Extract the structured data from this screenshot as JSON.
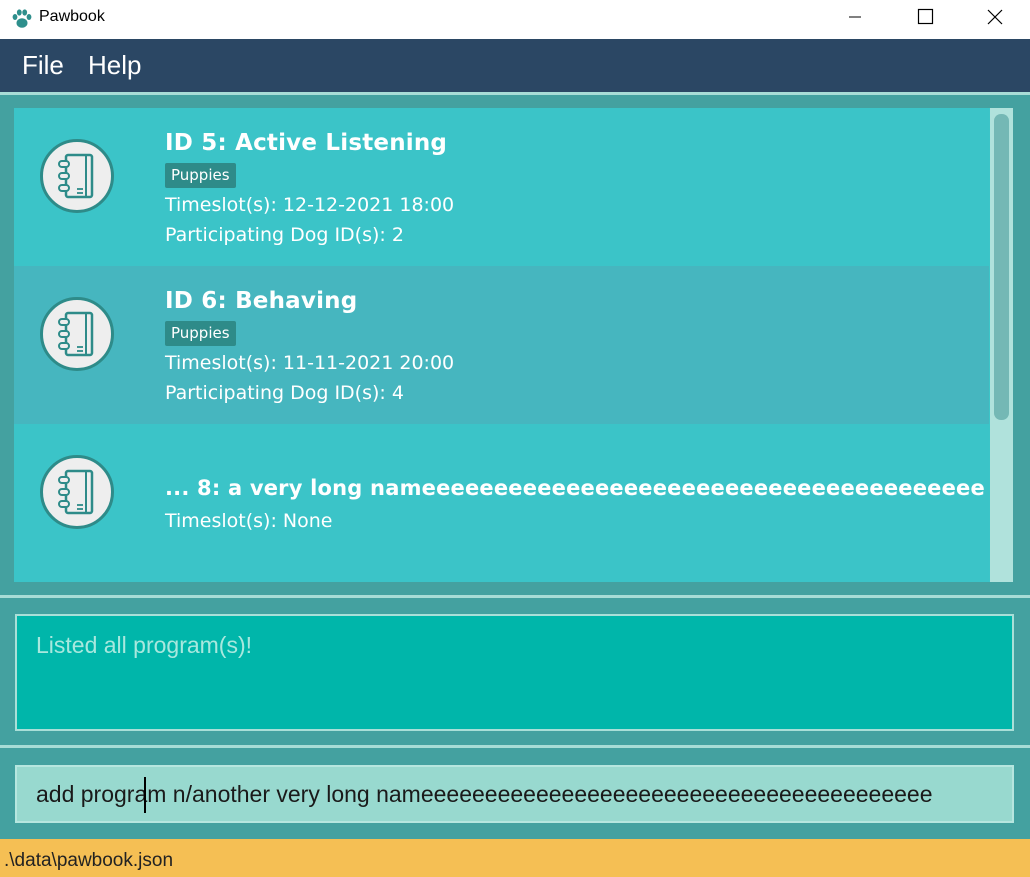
{
  "window": {
    "title": "Pawbook"
  },
  "menu": {
    "items": [
      "File",
      "Help"
    ]
  },
  "programs": [
    {
      "title": "ID 5:  Active Listening",
      "tag": "Puppies",
      "timeslot": "Timeslot(s): 12-12-2021 18:00",
      "dogs": "Participating Dog ID(s): 2"
    },
    {
      "title": "ID 6:  Behaving",
      "tag": "Puppies",
      "timeslot": "Timeslot(s): 11-11-2021 20:00",
      "dogs": "Participating Dog ID(s): 4"
    },
    {
      "title": "... 8:  a very long nameeeeeeeeeeeeeeeeeeeeeeeeeeeeeeeeeeeeeee...",
      "timeslot": "Timeslot(s): None"
    }
  ],
  "result": {
    "message": "Listed all program(s)!"
  },
  "command": {
    "value": "add program n/another very long nameeeeeeeeeeeeeeeeeeeeeeeeeeeeeeeeeeeeeeee"
  },
  "status": {
    "path": ".\\data\\pawbook.json"
  },
  "colors": {
    "menubar": "#2b4764",
    "main": "#44a1a0",
    "list": "#3cc5c8",
    "result": "#00b6aa",
    "status": "#f5bf54"
  },
  "icons": {
    "app": "paw-icon",
    "card": "notebook-icon"
  }
}
